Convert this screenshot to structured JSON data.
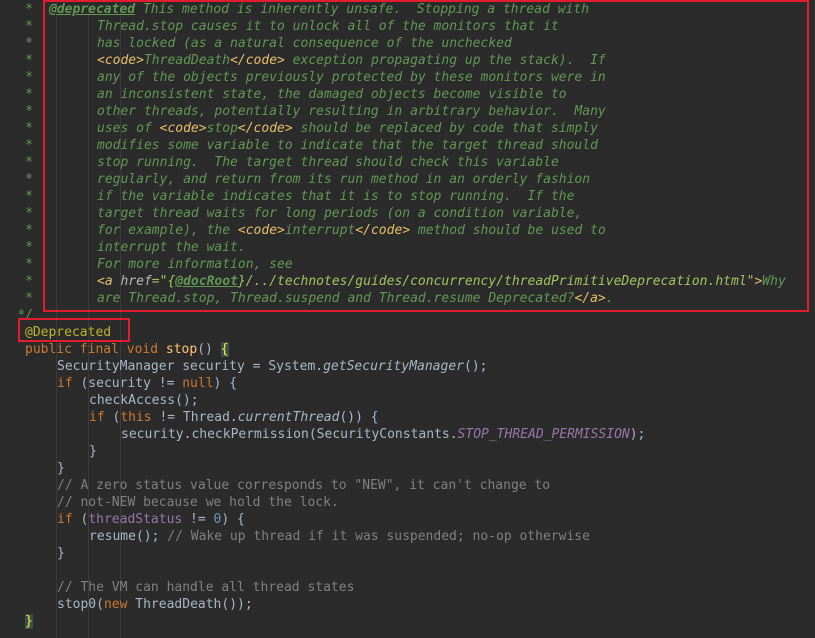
{
  "javadoc": {
    "star": "*",
    "end": "*/",
    "tag": "@deprecated",
    "lines": {
      "l0": " This method is inherently unsafe.  Stopping a thread with",
      "l1": "Thread.stop causes it to unlock all of the monitors that it",
      "l2": "has locked (as a natural consequence of the unchecked",
      "l3_a": "<code>",
      "l3_b": "ThreadDeath",
      "l3_c": "</code>",
      "l3_d": " exception propagating up the stack).  If",
      "l4": "any of the objects previously protected by these monitors were in",
      "l5": "an inconsistent state, the damaged objects become visible to",
      "l6": "other threads, potentially resulting in arbitrary behavior.  Many",
      "l7_a": "uses of ",
      "l7_b": "<code>",
      "l7_c": "stop",
      "l7_d": "</code>",
      "l7_e": " should be replaced by code that simply",
      "l8": "modifies some variable to indicate that the target thread should",
      "l9": "stop running.  The target thread should check this variable",
      "l10": "regularly, and return from its run method in an orderly fashion",
      "l11": "if the variable indicates that it is to stop running.  If the",
      "l12": "target thread waits for long periods (on a condition variable,",
      "l13_a": "for example), the ",
      "l13_b": "<code>",
      "l13_c": "interrupt",
      "l13_d": "</code>",
      "l13_e": " method should be used to",
      "l14": "interrupt the wait.",
      "l15": "For more information, see",
      "l16_a": "<a ",
      "l16_b": "href",
      "l16_c": "=\"{",
      "l16_d": "@docRoot",
      "l16_e": "}/../technotes/guides/concurrency/threadPrimitiveDeprecation.html\"",
      "l16_f": ">",
      "l16_g": "Why",
      "l17_a": "are Thread.stop, Thread.suspend and Thread.resume Deprecated?",
      "l17_b": "</a>",
      "l17_c": "."
    }
  },
  "code": {
    "annotation": "@Deprecated",
    "sig_kw": "public final void ",
    "sig_name": "stop",
    "sig_parens": "() ",
    "sig_brace": "{",
    "c1_a": "SecurityManager security = System.",
    "c1_b": "getSecurityManager",
    "c1_c": "();",
    "c2_a": "if",
    "c2_b": " (security != ",
    "c2_c": "null",
    "c2_d": ") {",
    "c3": "checkAccess();",
    "c4_a": "if",
    "c4_b": " (",
    "c4_c": "this",
    "c4_d": " != Thread.",
    "c4_e": "currentThread",
    "c4_f": "()) {",
    "c5_a": "security.checkPermission(SecurityConstants.",
    "c5_b": "STOP_THREAD_PERMISSION",
    "c5_c": ");",
    "c6": "}",
    "c7": "}",
    "c8": "// A zero status value corresponds to \"NEW\", it can't change to",
    "c9": "// not-NEW because we hold the lock.",
    "c10_a": "if",
    "c10_b": " (",
    "c10_c": "threadStatus",
    "c10_d": " != ",
    "c10_e": "0",
    "c10_f": ") {",
    "c11_a": "resume();",
    "c11_b": " // Wake up thread if it was suspended; no-op otherwise",
    "c12": "}",
    "c13": "// The VM can handle all thread states",
    "c14_a": "stop0(",
    "c14_b": "new",
    "c14_c": " ThreadDeath());",
    "c15": "}"
  },
  "colors": {
    "background": "#2b2b2b",
    "highlight_box": "#e11d2e"
  }
}
